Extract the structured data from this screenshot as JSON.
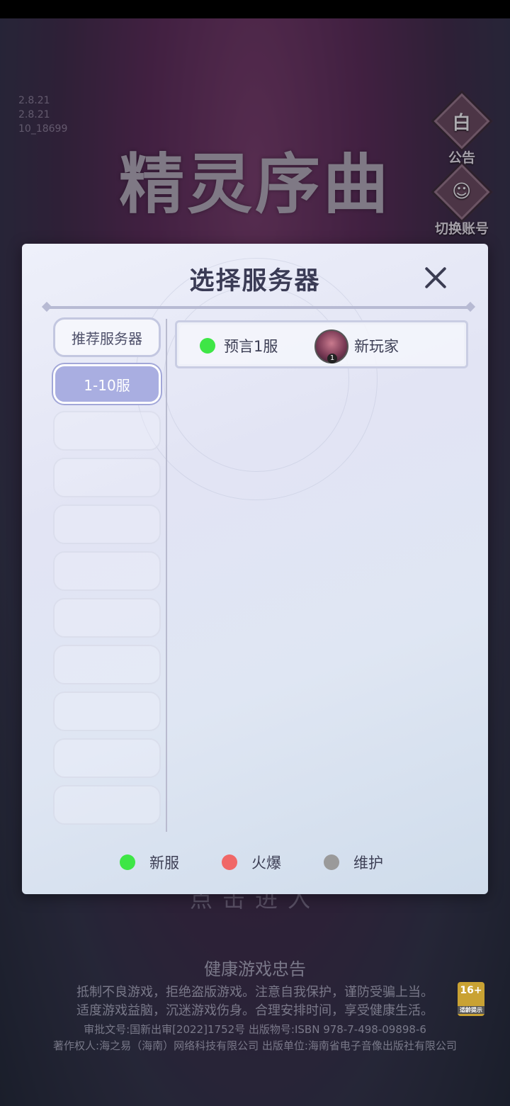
{
  "background": {
    "version_lines": [
      "2.8.21",
      "2.8.21",
      "10_18699"
    ],
    "logo_text": "精灵序曲",
    "side_buttons": [
      {
        "label": "公告",
        "icon": "notice-icon"
      },
      {
        "label": "切换账号",
        "icon": "switch-account-icon"
      }
    ],
    "hint_text": "点击进入"
  },
  "modal": {
    "title": "选择服务器",
    "tabs": [
      {
        "label": "推荐服务器",
        "state": "normal"
      },
      {
        "label": "1-10服",
        "state": "active"
      },
      {
        "label": "",
        "state": "empty"
      },
      {
        "label": "",
        "state": "empty"
      },
      {
        "label": "",
        "state": "empty"
      },
      {
        "label": "",
        "state": "empty"
      },
      {
        "label": "",
        "state": "empty"
      },
      {
        "label": "",
        "state": "empty"
      },
      {
        "label": "",
        "state": "empty"
      },
      {
        "label": "",
        "state": "empty"
      },
      {
        "label": "",
        "state": "empty"
      }
    ],
    "servers": [
      {
        "name": "预言1服",
        "status": "new",
        "status_color": "#3ee646",
        "player_name": "新玩家",
        "player_level": "1"
      }
    ],
    "legend": [
      {
        "label": "新服",
        "color": "#3ee646"
      },
      {
        "label": "火爆",
        "color": "#f06767"
      },
      {
        "label": "维护",
        "color": "#9a9a9a"
      }
    ]
  },
  "footer": {
    "title": "健康游戏忠告",
    "lines": [
      "抵制不良游戏，拒绝盗版游戏。注意自我保护，谨防受骗上当。",
      "适度游戏益脑，沉迷游戏伤身。合理安排时间，享受健康生活。"
    ],
    "approval": "审批文号:国新出审[2022]1752号 出版物号:ISBN 978-7-498-09898-6",
    "copyright": "著作权人:海之易（海南）网络科技有限公司 出版单位:海南省电子音像出版社有限公司",
    "age_rating": "16+",
    "age_note": "适龄提示"
  }
}
